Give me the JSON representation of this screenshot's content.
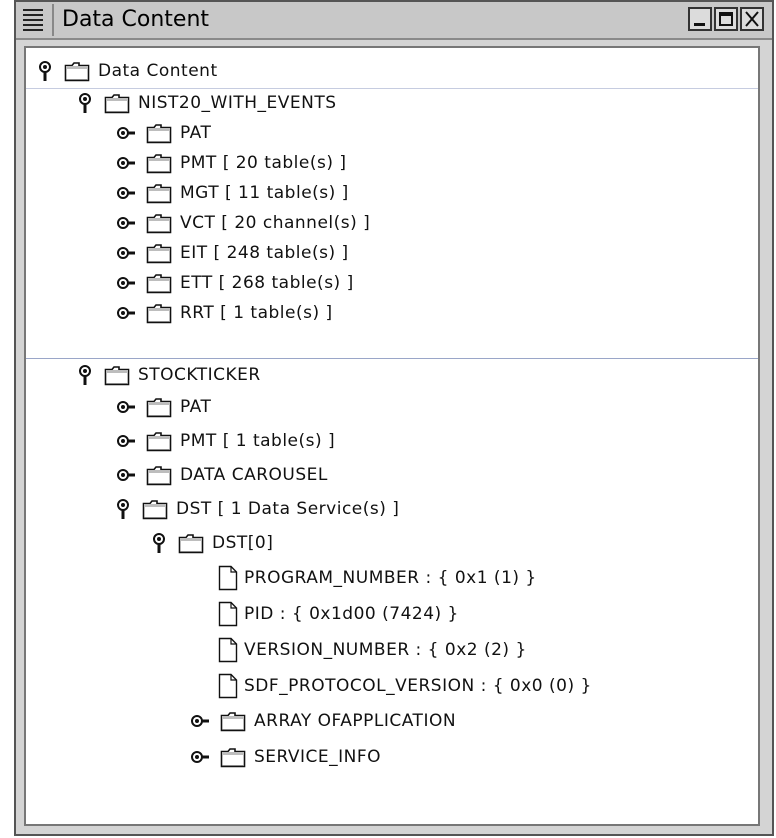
{
  "window": {
    "title": "Data Content"
  },
  "tree": {
    "root": "Data Content",
    "stream1": {
      "label": "NIST20_WITH_EVENTS",
      "pat": "PAT",
      "pmt": "PMT  [ 20 table(s) ]",
      "mgt": "MGT  [ 11 table(s) ]",
      "vct": "VCT  [ 20 channel(s) ]",
      "eit": "EIT   [ 248 table(s) ]",
      "ett": "ETT  [ 268 table(s) ]",
      "rrt": "RRT  [ 1 table(s) ]"
    },
    "stream2": {
      "label": "STOCKTICKER",
      "pat": "PAT",
      "pmt": "PMT  [ 1 table(s) ]",
      "carousel": "DATA CAROUSEL",
      "dst": "DST  [ 1 Data Service(s) ]",
      "dst0": {
        "label": "DST[0]",
        "program_number": "PROGRAM_NUMBER : { 0x1  (1) }",
        "pid": "PID : { 0x1d00  (7424) }",
        "version_number": "VERSION_NUMBER : { 0x2  (2) }",
        "sdf_protocol_version": "SDF_PROTOCOL_VERSION : { 0x0  (0) }",
        "array_of_application": "ARRAY OFAPPLICATION",
        "service_info": "SERVICE_INFO"
      }
    }
  },
  "icons": {
    "expanded": "expanded-node-icon",
    "collapsed": "collapsed-node-icon",
    "folder": "folder-icon",
    "document": "document-icon"
  }
}
